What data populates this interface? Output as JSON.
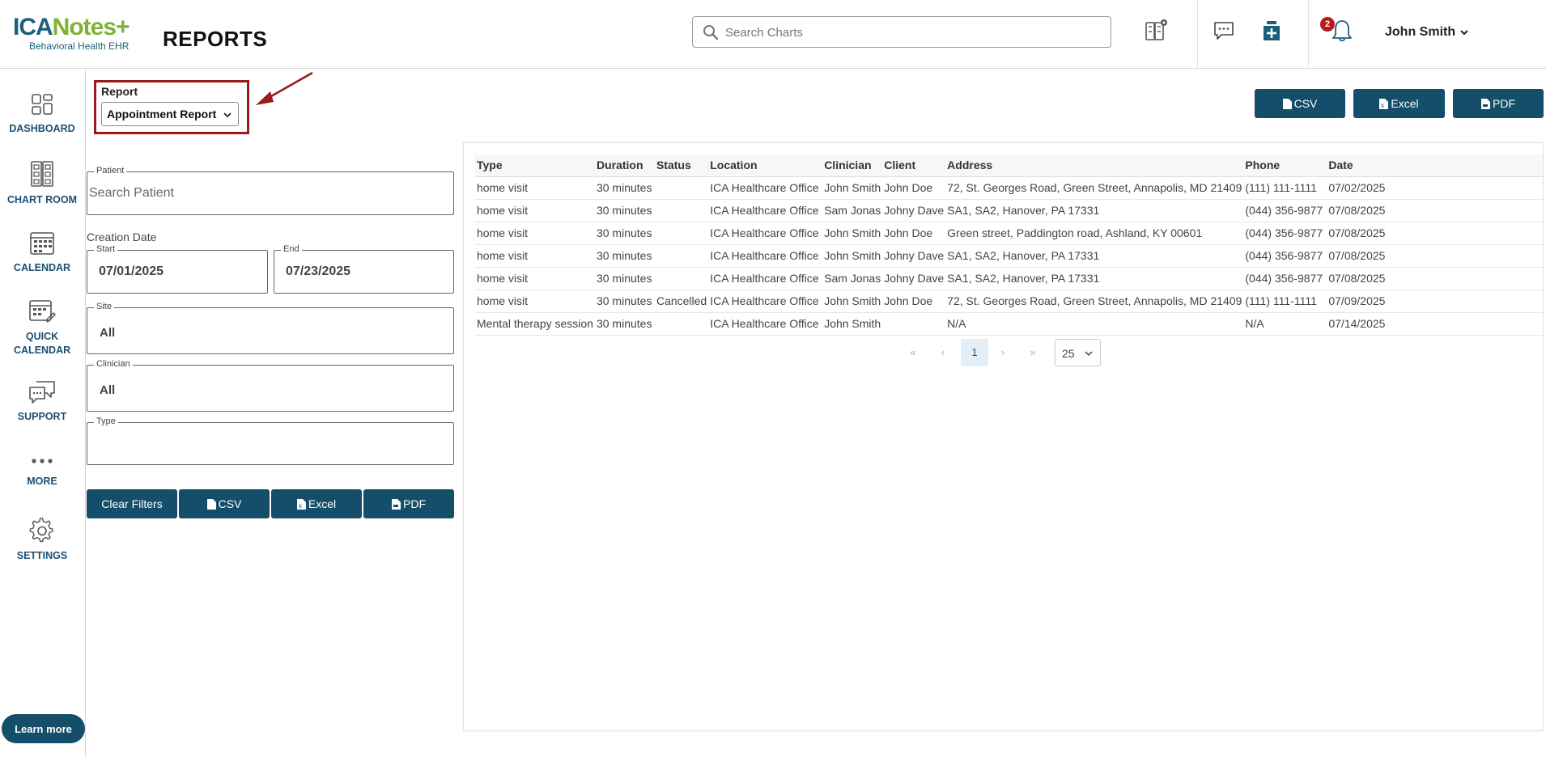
{
  "app": {
    "logo_main_1": "ICA",
    "logo_main_2": "Notes+",
    "logo_sub": "Behavioral Health EHR",
    "page_title": "REPORTS"
  },
  "search": {
    "placeholder": "Search Charts"
  },
  "notifications": {
    "count": "2"
  },
  "user": {
    "name": "John Smith"
  },
  "sidebar": {
    "items": [
      {
        "label": "DASHBOARD"
      },
      {
        "label": "CHART ROOM"
      },
      {
        "label": "CALENDAR"
      },
      {
        "label": "QUICK CALENDAR"
      },
      {
        "label": "SUPPORT"
      },
      {
        "label": "MORE"
      },
      {
        "label": "SETTINGS"
      }
    ],
    "learn_more": "Learn more"
  },
  "report": {
    "label": "Report",
    "selected": "Appointment Report"
  },
  "filters": {
    "patient_legend": "Patient",
    "patient_placeholder": "Search Patient",
    "creation_date_label": "Creation Date",
    "start_legend": "Start",
    "start_value": "07/01/2025",
    "end_legend": "End",
    "end_value": "07/23/2025",
    "site_legend": "Site",
    "site_value": "All",
    "clinician_legend": "Clinician",
    "clinician_value": "All",
    "type_legend": "Type",
    "type_value": ""
  },
  "buttons": {
    "clear_filters": "Clear Filters",
    "csv": "CSV",
    "excel": "Excel",
    "pdf": "PDF"
  },
  "table": {
    "headers": [
      "Type",
      "Duration",
      "Status",
      "Location",
      "Clinician",
      "Client",
      "Address",
      "Phone",
      "Date"
    ],
    "rows": [
      [
        "home visit",
        "30 minutes",
        "",
        "ICA Healthcare Office",
        "John Smith",
        "John Doe",
        "72, St. Georges Road, Green Street, Annapolis, MD 21409",
        "(111) 111-1111",
        "07/02/2025"
      ],
      [
        "home visit",
        "30 minutes",
        "",
        "ICA Healthcare Office",
        "Sam Jonas",
        "Johny Dave",
        "SA1, SA2, Hanover, PA 17331",
        "(044) 356-9877",
        "07/08/2025"
      ],
      [
        "home visit",
        "30 minutes",
        "",
        "ICA Healthcare Office",
        "John Smith",
        "John Doe",
        "Green street, Paddington road, Ashland, KY 00601",
        "(044) 356-9877",
        "07/08/2025"
      ],
      [
        "home visit",
        "30 minutes",
        "",
        "ICA Healthcare Office",
        "John Smith",
        "Johny Dave",
        "SA1, SA2, Hanover, PA 17331",
        "(044) 356-9877",
        "07/08/2025"
      ],
      [
        "home visit",
        "30 minutes",
        "",
        "ICA Healthcare Office",
        "Sam Jonas",
        "Johny Dave",
        "SA1, SA2, Hanover, PA 17331",
        "(044) 356-9877",
        "07/08/2025"
      ],
      [
        "home visit",
        "30 minutes",
        "Cancelled",
        "ICA Healthcare Office",
        "John Smith",
        "John Doe",
        "72, St. Georges Road, Green Street, Annapolis, MD 21409",
        "(111) 111-1111",
        "07/09/2025"
      ],
      [
        "Mental therapy session",
        "30 minutes",
        "",
        "ICA Healthcare Office",
        "John Smith",
        "",
        "N/A",
        "N/A",
        "07/14/2025"
      ]
    ]
  },
  "pagination": {
    "first": "«",
    "prev": "‹",
    "current": "1",
    "next": "›",
    "last": "»",
    "page_size": "25"
  },
  "colors": {
    "primary": "#144e6a",
    "highlight_border": "#9b1b1b",
    "badge": "#b71c1c"
  }
}
